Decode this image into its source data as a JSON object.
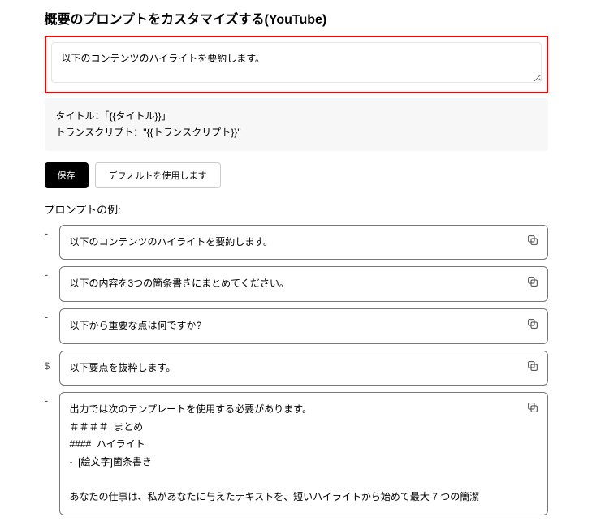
{
  "heading": "概要のプロンプトをカスタマイズする(YouTube)",
  "prompt_textarea": {
    "value": "以下のコンテンツのハイライトを要約します。"
  },
  "template_box": "タイトル：「{{タイトル}}」\nトランスクリプト：\"{{トランスクリプト}}\"",
  "buttons": {
    "save": "保存",
    "use_default": "デフォルトを使用します"
  },
  "examples_label": "プロンプトの例:",
  "examples": [
    {
      "collapse": "-",
      "prefix": "",
      "text": "以下のコンテンツのハイライトを要約します。"
    },
    {
      "collapse": "-",
      "prefix": "",
      "text": "以下の内容を3つの箇条書きにまとめてください。"
    },
    {
      "collapse": "-",
      "prefix": "",
      "text": "以下から重要な点は何ですか?"
    },
    {
      "collapse": "",
      "prefix": "$",
      "text": "以下要点を抜粋します。"
    },
    {
      "collapse": "-",
      "prefix": "",
      "text": "出力では次のテンプレートを使用する必要があります。\n＃＃＃＃  まとめ\n####  ハイライト\n-  [絵文字]箇条書き\n\nあなたの仕事は、私があなたに与えたテキストを、短いハイライトから始めて最大 7 つの簡潔"
    }
  ]
}
